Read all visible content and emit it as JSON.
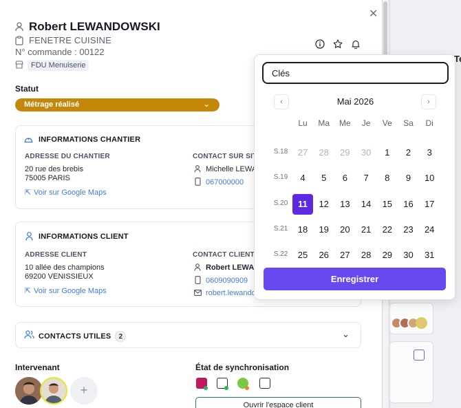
{
  "header": {
    "client_name": "Robert LEWANDOWSKI",
    "project": "FENETRE CUISINE",
    "order": "N° commande : 00122",
    "tag": "FDU Menuiserie"
  },
  "statut": {
    "label": "Statut",
    "value": "Métrage réalisé"
  },
  "chantier": {
    "title": "INFORMATIONS CHANTIER",
    "address_label": "ADRESSE DU CHANTIER",
    "address_line1": "20 rue des brebis",
    "address_line2": "75005 PARIS",
    "maps_link": "Voir sur Google Maps",
    "contact_label": "CONTACT SUR SITE",
    "contact_name": "Michelle LEWA",
    "contact_phone": "067000000"
  },
  "client": {
    "title": "INFORMATIONS CLIENT",
    "address_label": "ADRESSE CLIENT",
    "address_line1": "10 allée des champions",
    "address_line2": "69200 VENISSIEUX",
    "maps_link": "Voir sur Google Maps",
    "contact_label": "CONTACT CLIENT",
    "contact_name": "Robert LEWAN",
    "contact_phone": "0609090909",
    "contact_email": "robert.lewando"
  },
  "contacts": {
    "title": "CONTACTS UTILES",
    "count": "2"
  },
  "intervenant": {
    "label": "Intervenant",
    "add": "+"
  },
  "sync": {
    "label": "État de synchronisation",
    "open_button": "Ouvrir l'espace client"
  },
  "calendar": {
    "input_value": "Clés",
    "month": "Mai 2026",
    "prev": "‹",
    "next": "›",
    "weekdays": [
      "Lu",
      "Ma",
      "Me",
      "Je",
      "Ve",
      "Sa",
      "Di"
    ],
    "weeks": [
      {
        "label": "S.18",
        "days": [
          "27",
          "28",
          "29",
          "30",
          "1",
          "2",
          "3"
        ],
        "muted": [
          true,
          true,
          true,
          true,
          false,
          false,
          false
        ]
      },
      {
        "label": "S.19",
        "days": [
          "4",
          "5",
          "6",
          "7",
          "8",
          "9",
          "10"
        ],
        "muted": [
          false,
          false,
          false,
          false,
          false,
          false,
          false
        ]
      },
      {
        "label": "S.20",
        "days": [
          "11",
          "12",
          "13",
          "14",
          "15",
          "16",
          "17"
        ],
        "muted": [
          false,
          false,
          false,
          false,
          false,
          false,
          false
        ]
      },
      {
        "label": "S.21",
        "days": [
          "18",
          "19",
          "20",
          "21",
          "22",
          "23",
          "24"
        ],
        "muted": [
          false,
          false,
          false,
          false,
          false,
          false,
          false
        ]
      },
      {
        "label": "S.22",
        "days": [
          "25",
          "26",
          "27",
          "28",
          "29",
          "30",
          "31"
        ],
        "muted": [
          false,
          false,
          false,
          false,
          false,
          false,
          false
        ]
      }
    ],
    "selected_day": "11",
    "save_label": "Enregistrer"
  },
  "background": {
    "column_heading": "Te"
  },
  "colors": {
    "statut": "#c5870a",
    "accent": "#6848f0",
    "selected": "#5b2be0",
    "link": "#3f7bd8"
  }
}
